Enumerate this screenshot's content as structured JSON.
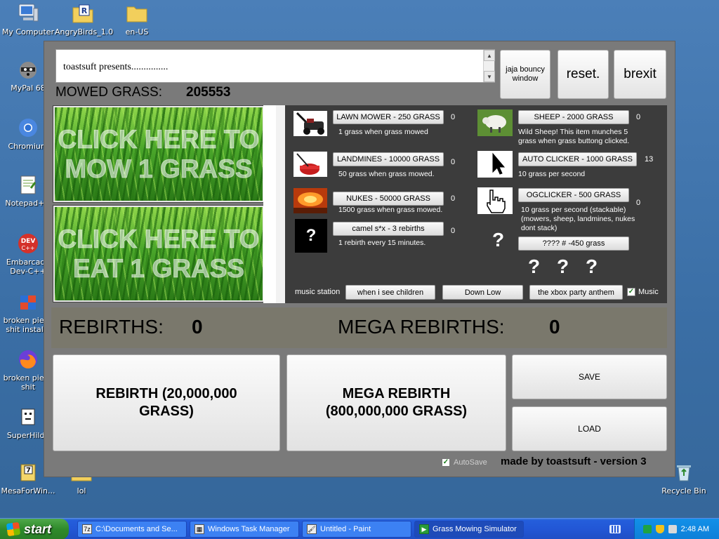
{
  "desktop": {
    "icons": [
      {
        "label": "My Computer",
        "glyph": "🖥"
      },
      {
        "label": "AngryBirds_1.0",
        "glyph": "R"
      },
      {
        "label": "en-US",
        "glyph": "📁"
      },
      {
        "label": "MyPal 68",
        "glyph": "🦝"
      },
      {
        "label": "Chromium",
        "glyph": "◉"
      },
      {
        "label": "Notepad++",
        "glyph": "📝"
      },
      {
        "label": "Embarcadero Dev-C++",
        "label_line1": "Embarcade",
        "label_line2": "Dev-C++",
        "glyph": "DEV"
      },
      {
        "label_line1": "broken piece",
        "label_line2": "shit installe",
        "glyph": "📦"
      },
      {
        "label_line1": "broken piece",
        "label_line2": "shit",
        "glyph": "🦊"
      },
      {
        "label": "SuperHilda",
        "glyph": "🧩"
      },
      {
        "label": "MesaForWin...",
        "glyph": "7"
      },
      {
        "label": "lol",
        "glyph": "📁"
      },
      {
        "label": "Recycle Bin",
        "glyph": "♻"
      }
    ]
  },
  "app": {
    "intro_text": "toastsuft presents...............",
    "buttons": {
      "bouncy": "jaja bouncy window",
      "reset": "reset.",
      "brexit": "brexit"
    },
    "mowed_label": "MOWED GRASS:",
    "mowed_value": "205553",
    "mow_button": "CLICK HERE TO MOW 1 GRASS",
    "eat_button": "CLICK HERE TO EAT 1 GRASS",
    "shop": {
      "lawnmower": {
        "label": "LAWN MOWER - 250 GRASS",
        "count": "0",
        "desc": "1 grass when grass mowed",
        "icon": "lawnmower-icon"
      },
      "landmines": {
        "label": "LANDMINES - 10000 GRASS",
        "count": "0",
        "desc": "50 grass when grass mowed.",
        "icon": "landmine-icon"
      },
      "nukes": {
        "label": "NUKES - 50000 GRASS",
        "count": "0",
        "desc": "1500 grass when grass mowed.",
        "icon": "explosion-icon"
      },
      "camel": {
        "label": "camel s*x - 3 rebirths",
        "count": "0",
        "desc": "1 rebirth every 15 minutes.",
        "icon": "question-icon"
      },
      "sheep": {
        "label": "SHEEP - 2000 GRASS",
        "count": "0",
        "desc_line1": "Wild Sheep! This item munches 5",
        "desc_line2": "grass when grass buttong clicked.",
        "icon": "sheep-icon"
      },
      "autoclicker": {
        "label": "AUTO CLICKER - 1000 GRASS",
        "count": "13",
        "desc": "10 grass per second",
        "icon": "cursor-icon"
      },
      "ogclicker": {
        "label": "OGCLICKER - 500 GRASS",
        "count": "0",
        "desc_line1": "10 grass per second (stackable)",
        "desc_line2": "(mowers, sheep, landmines, nukes",
        "desc_line3": "dont stack)",
        "icon": "hand-pointer-icon"
      },
      "mystery": {
        "label": "???? # -450 grass",
        "qmark_single": "?",
        "qmarks": [
          "?",
          "?",
          "?"
        ]
      },
      "music_label": "music station",
      "songs": [
        "when i see children",
        "Down Low",
        "the xbox party anthem"
      ],
      "music_checkbox": "Music",
      "music_checked": true
    },
    "rebirths_label": "REBIRTHS:",
    "rebirths_value": "0",
    "mega_label": "MEGA REBIRTHS:",
    "mega_value": "0",
    "rebirth_button_line1": "REBIRTH (20,000,000",
    "rebirth_button_line2": "GRASS)",
    "mega_button_line1": "MEGA REBIRTH",
    "mega_button_line2": "(800,000,000 GRASS)",
    "save_label": "SAVE",
    "load_label": "LOAD",
    "autosave_label": "AutoSave",
    "autosave_checked": true,
    "credit": "made by toastsuft - version 3"
  },
  "taskbar": {
    "start_label": "start",
    "tasks": [
      {
        "label": "C:\\Documents and Se...",
        "icon": "7z"
      },
      {
        "label": "Windows Task Manager",
        "icon": "▦"
      },
      {
        "label": "Untitled - Paint",
        "icon": "🖌"
      },
      {
        "label": "Grass Mowing Simulator",
        "icon": "▶"
      }
    ],
    "clock": "2:48 AM"
  },
  "colors": {
    "desktop": "#3a6ea5",
    "window": "#7a7a7a",
    "shop_panel": "#3c3c3c",
    "rebirth_bar": "#7a786c",
    "taskbar": "#245edb",
    "start": "#2f8a2b"
  }
}
